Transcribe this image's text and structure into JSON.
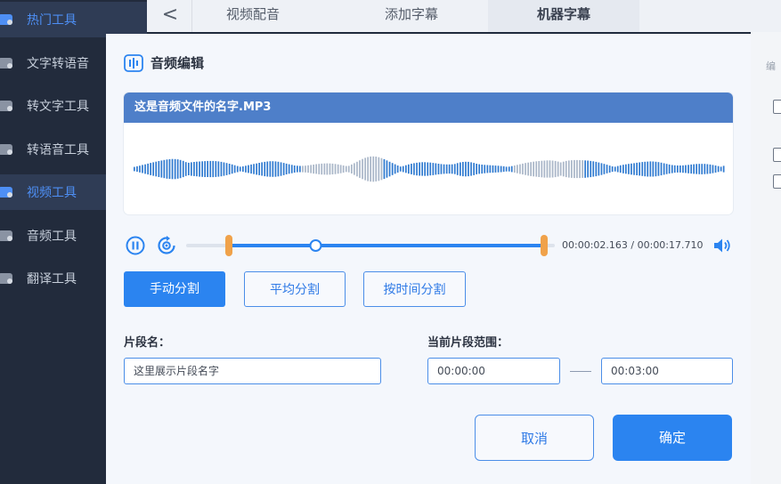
{
  "sidebar": {
    "items": [
      {
        "label": "热门工具",
        "active": true
      },
      {
        "label": "文字转语音",
        "active": false
      },
      {
        "label": "转文字工具",
        "active": false
      },
      {
        "label": "转语音工具",
        "active": false
      },
      {
        "label": "视频工具",
        "active": true
      },
      {
        "label": "音频工具",
        "active": false
      },
      {
        "label": "翻译工具",
        "active": false
      }
    ]
  },
  "topbar": {
    "back_symbol": "<",
    "tabs": [
      {
        "label": "视频配音",
        "active": false
      },
      {
        "label": "添加字幕",
        "active": false
      },
      {
        "label": "机器字幕",
        "active": true
      }
    ]
  },
  "right_panel": {
    "label": "编"
  },
  "dialog": {
    "title": "音频编辑",
    "file_name": "这是音频文件的名字.MP3",
    "player": {
      "current_time": "00:00:02.163",
      "total_time": "00:00:17.710",
      "time_separator": " / ",
      "playhead_fraction": 0.12,
      "selection_start_fraction": 0.0,
      "selection_end_fraction": 1.0
    },
    "split_buttons": {
      "manual": "手动分割",
      "average": "平均分割",
      "by_time": "按时间分割"
    },
    "segment_name_label": "片段名：",
    "segment_name_value": "这里展示片段名字",
    "range_label": "当前片段范围：",
    "range_start": "00:00:00",
    "range_end": "00:03:00",
    "cancel_label": "取消",
    "confirm_label": "确定"
  },
  "colors": {
    "accent": "#2b84f0",
    "wave_dark": "#2f7ad0",
    "wave_light": "#a9b6c8",
    "handle": "#f0a24a",
    "header": "#4e7fc9"
  }
}
